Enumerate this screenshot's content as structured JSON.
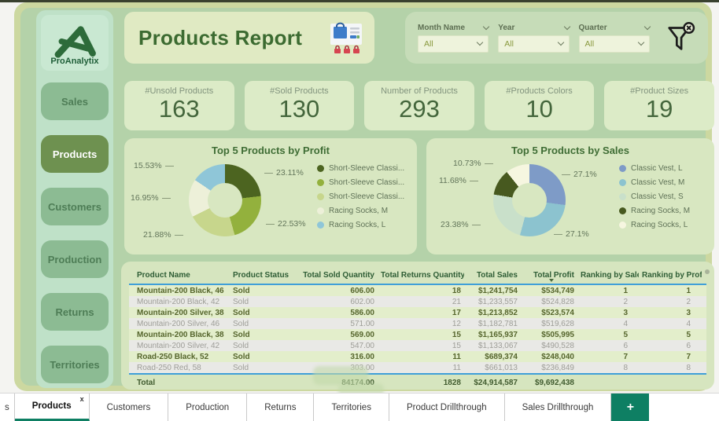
{
  "brand": {
    "name": "ProAnalytix"
  },
  "header": {
    "title": "Products Report"
  },
  "filters": {
    "items": [
      {
        "label": "Month Name",
        "value": "All"
      },
      {
        "label": "Year",
        "value": "All"
      },
      {
        "label": "Quarter",
        "value": "All"
      }
    ]
  },
  "sidebar": {
    "items": [
      {
        "label": "Sales"
      },
      {
        "label": "Products",
        "active": true
      },
      {
        "label": "Customers"
      },
      {
        "label": "Production"
      },
      {
        "label": "Returns"
      },
      {
        "label": "Territories"
      }
    ]
  },
  "kpis": [
    {
      "label": "#Unsold Products",
      "value": "163"
    },
    {
      "label": "#Sold Products",
      "value": "130"
    },
    {
      "label": "Number of Products",
      "value": "293"
    },
    {
      "label": "#Products Colors",
      "value": "10"
    },
    {
      "label": "#Product Sizes",
      "value": "19"
    }
  ],
  "chart_data": [
    {
      "type": "pie",
      "donut": true,
      "title": "Top 5 Products by Profit",
      "labels": [
        "Short-Sleeve Classi...",
        "Short-Sleeve Classi...",
        "Short-Sleeve Classi...",
        "Racing Socks, M",
        "Racing Socks, L"
      ],
      "values": [
        23.11,
        22.53,
        21.88,
        16.95,
        15.53
      ],
      "value_labels": [
        "23.11%",
        "22.53%",
        "21.88%",
        "16.95%",
        "15.53%"
      ],
      "colors": [
        "#4c6420",
        "#93b13d",
        "#c7d68c",
        "#edf0d9",
        "#8fc6d8"
      ],
      "legend_position": "right"
    },
    {
      "type": "pie",
      "donut": true,
      "title": "Top 5 Products by Sales",
      "labels": [
        "Classic Vest, L",
        "Classic Vest, M",
        "Classic Vest, S",
        "Racing Socks, M",
        "Racing Socks, L"
      ],
      "values": [
        27.1,
        27.1,
        23.38,
        11.68,
        10.73
      ],
      "value_labels": [
        "27.1%",
        "27.1%",
        "23.38%",
        "11.68%",
        "10.73%"
      ],
      "colors": [
        "#7e9bc7",
        "#8cc3cf",
        "#c9e0ca",
        "#47591f",
        "#f6f6e0"
      ],
      "legend_position": "right"
    }
  ],
  "table": {
    "columns": [
      "Product Name",
      "Product Status",
      "Total Sold Quantity",
      "Total Returns Quantity",
      "Total Sales",
      "Total Profit",
      "Ranking by Sales",
      "Ranking by Profit"
    ],
    "sorted_column": "Total Sales",
    "rows": [
      [
        "Mountain-200 Black, 46",
        "Sold",
        "606.00",
        "18",
        "$1,241,754",
        "$534,749",
        "1",
        "1"
      ],
      [
        "Mountain-200 Black, 42",
        "Sold",
        "602.00",
        "21",
        "$1,233,557",
        "$524,828",
        "2",
        "2"
      ],
      [
        "Mountain-200 Silver, 38",
        "Sold",
        "586.00",
        "17",
        "$1,213,852",
        "$523,574",
        "3",
        "3"
      ],
      [
        "Mountain-200 Silver, 46",
        "Sold",
        "571.00",
        "12",
        "$1,182,781",
        "$519,628",
        "4",
        "4"
      ],
      [
        "Mountain-200 Black, 38",
        "Sold",
        "569.00",
        "15",
        "$1,165,937",
        "$505,995",
        "5",
        "5"
      ],
      [
        "Mountain-200 Silver, 42",
        "Sold",
        "547.00",
        "15",
        "$1,133,067",
        "$490,528",
        "6",
        "6"
      ],
      [
        "Road-250 Black, 52",
        "Sold",
        "316.00",
        "11",
        "$689,374",
        "$248,040",
        "7",
        "7"
      ],
      [
        "Road-250 Red, 58",
        "Sold",
        "303.00",
        "11",
        "$661,013",
        "$236,849",
        "8",
        "8"
      ]
    ],
    "total": [
      "Total",
      "",
      "84174.00",
      "1828",
      "$24,914,587",
      "$9,692,438",
      "",
      ""
    ]
  },
  "tabs": {
    "partial_label": "s",
    "close_glyph": "x",
    "add_label": "+",
    "items": [
      {
        "label": "Products",
        "active": true,
        "closable": true
      },
      {
        "label": "Customers"
      },
      {
        "label": "Production"
      },
      {
        "label": "Returns"
      },
      {
        "label": "Territories"
      },
      {
        "label": "Product Drillthrough"
      },
      {
        "label": "Sales Drillthrough"
      }
    ]
  },
  "watermark": {
    "text": "ndreziy.com"
  },
  "colors": {
    "accent_teal": "#0e7f63",
    "table_accent_blue": "#3f9fd8",
    "canvas_border": "#ccd8a0",
    "main_panel": "#b4d2a9",
    "sidebar_bg": "#bfe1c8",
    "card_bg": "#dcebc7",
    "nav_active": "#6e9150",
    "title_green": "#3c6b31"
  }
}
